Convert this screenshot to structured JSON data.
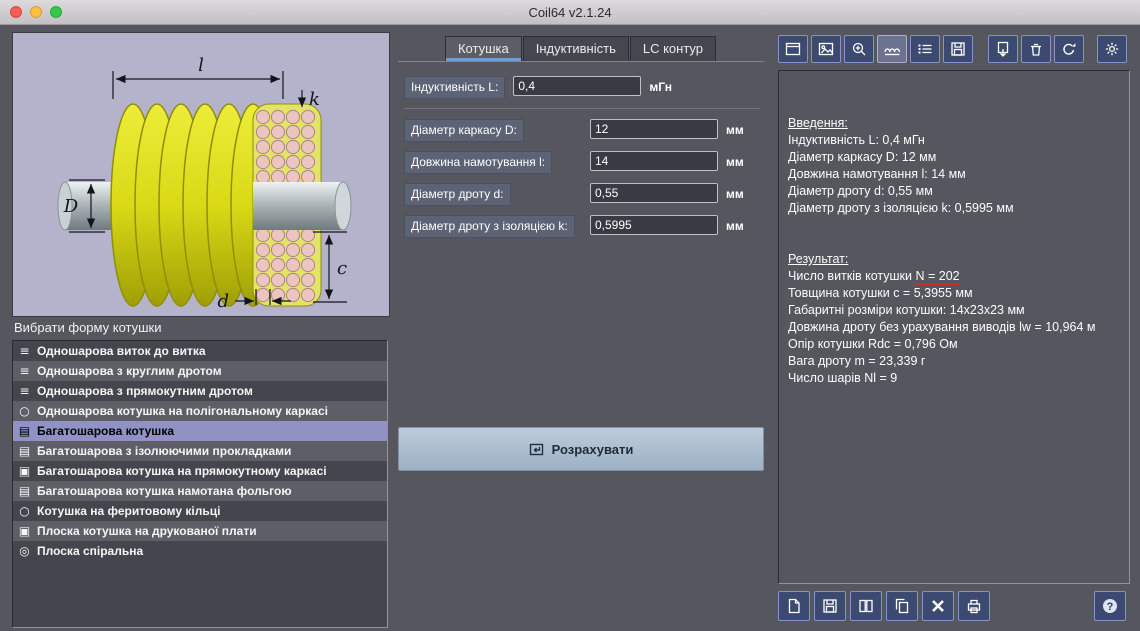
{
  "window": {
    "title": "Coil64 v2.1.24"
  },
  "left_panel": {
    "diagram": {
      "dim_l": "l",
      "dim_k": "k",
      "dim_D": "D",
      "dim_c": "c",
      "dim_d": "d"
    },
    "select_label": "Вибрати форму котушки",
    "coil_types": [
      {
        "label": "Одношарова виток до витка",
        "icon": "single-layer-close-wound-icon",
        "glyph": "≡",
        "selected": false
      },
      {
        "label": "Одношарова з круглим дротом",
        "icon": "single-layer-round-wire-icon",
        "glyph": "≡",
        "selected": false
      },
      {
        "label": "Одношарова з прямокутним дротом",
        "icon": "single-layer-rect-wire-icon",
        "glyph": "≡",
        "selected": false
      },
      {
        "label": "Одношарова котушка на полігональному каркасі",
        "icon": "polygonal-former-coil-icon",
        "glyph": "○",
        "selected": false
      },
      {
        "label": "Багатошарова котушка",
        "icon": "multilayer-coil-icon",
        "glyph": "▤",
        "selected": true
      },
      {
        "label": "Багатошарова з ізолюючими прокладками",
        "icon": "multilayer-insulated-pads-icon",
        "glyph": "▤",
        "selected": false
      },
      {
        "label": "Багатошарова котушка на прямокутному каркасі",
        "icon": "multilayer-rect-former-icon",
        "glyph": "▣",
        "selected": false
      },
      {
        "label": "Багатошарова котушка намотана фольгою",
        "icon": "multilayer-foil-icon",
        "glyph": "▤",
        "selected": false
      },
      {
        "label": "Котушка на феритовому кільці",
        "icon": "ferrite-ring-coil-icon",
        "glyph": "○",
        "selected": false
      },
      {
        "label": "Плоска котушка на друкованої плати",
        "icon": "pcb-coil-icon",
        "glyph": "▣",
        "selected": false
      },
      {
        "label": "Плоска спіральна",
        "icon": "flat-spiral-coil-icon",
        "glyph": "◎",
        "selected": false
      }
    ]
  },
  "tabs": {
    "coil": "Котушка",
    "inductance": "Індуктивність",
    "lc": "LC контур"
  },
  "form": {
    "inductance_label": "Індуктивність L:",
    "inductance_value": "0,4",
    "inductance_unit": "мГн",
    "rows": [
      {
        "label": "Діаметр каркасу D:",
        "value": "12",
        "unit": "мм"
      },
      {
        "label": "Довжина намотування l:",
        "value": "14",
        "unit": "мм"
      },
      {
        "label": "Діаметр дроту d:",
        "value": "0,55",
        "unit": "мм"
      },
      {
        "label": "Діаметр дроту з ізоляцією k:",
        "value": "0,5995",
        "unit": "мм"
      }
    ],
    "calculate_label": "Розрахувати"
  },
  "results": {
    "input_header": "Введення:",
    "input_lines": [
      "Індуктивність L: 0,4 мГн",
      "Діаметр каркасу D: 12 мм",
      "Довжина намотування l: 14 мм",
      "Діаметр дроту d: 0,55 мм",
      "Діаметр дроту з ізоляцією k: 0,5995 мм"
    ],
    "result_header": "Результат:",
    "turns_prefix": "Число витків котушки ",
    "turns_value": "N = 202",
    "result_lines": [
      "Товщина котушки c = 5,3955 мм",
      "Габаритні розміри котушки: 14x23x23 мм",
      "Довжина дроту без урахування виводів lw = 10,964 м",
      "Опір котушки Rdc = 0,796 Ом",
      "Вага дроту m = 23,339 г",
      "Число шарів Nl = 9"
    ]
  },
  "toolbars": {
    "top": [
      "new-window",
      "image",
      "zoom-in",
      "coil-mode",
      "list",
      "save-data",
      "export",
      "delete",
      "reset",
      "settings"
    ],
    "bottom": [
      "report",
      "save",
      "pages",
      "copy",
      "clear",
      "print",
      "help"
    ],
    "help_glyph": "?"
  },
  "colors": {
    "window_bg": "#56565e",
    "image_bg": "#b5b3cb",
    "selected_row": "#9191c4",
    "toolbar_button_bg": "#3c4a72",
    "toolbar_button_border": "#8494c8",
    "calc_button_bg": "#aabfd0",
    "red_underline": "#cf2b2b",
    "tab_accent": "#6f9fd6"
  }
}
